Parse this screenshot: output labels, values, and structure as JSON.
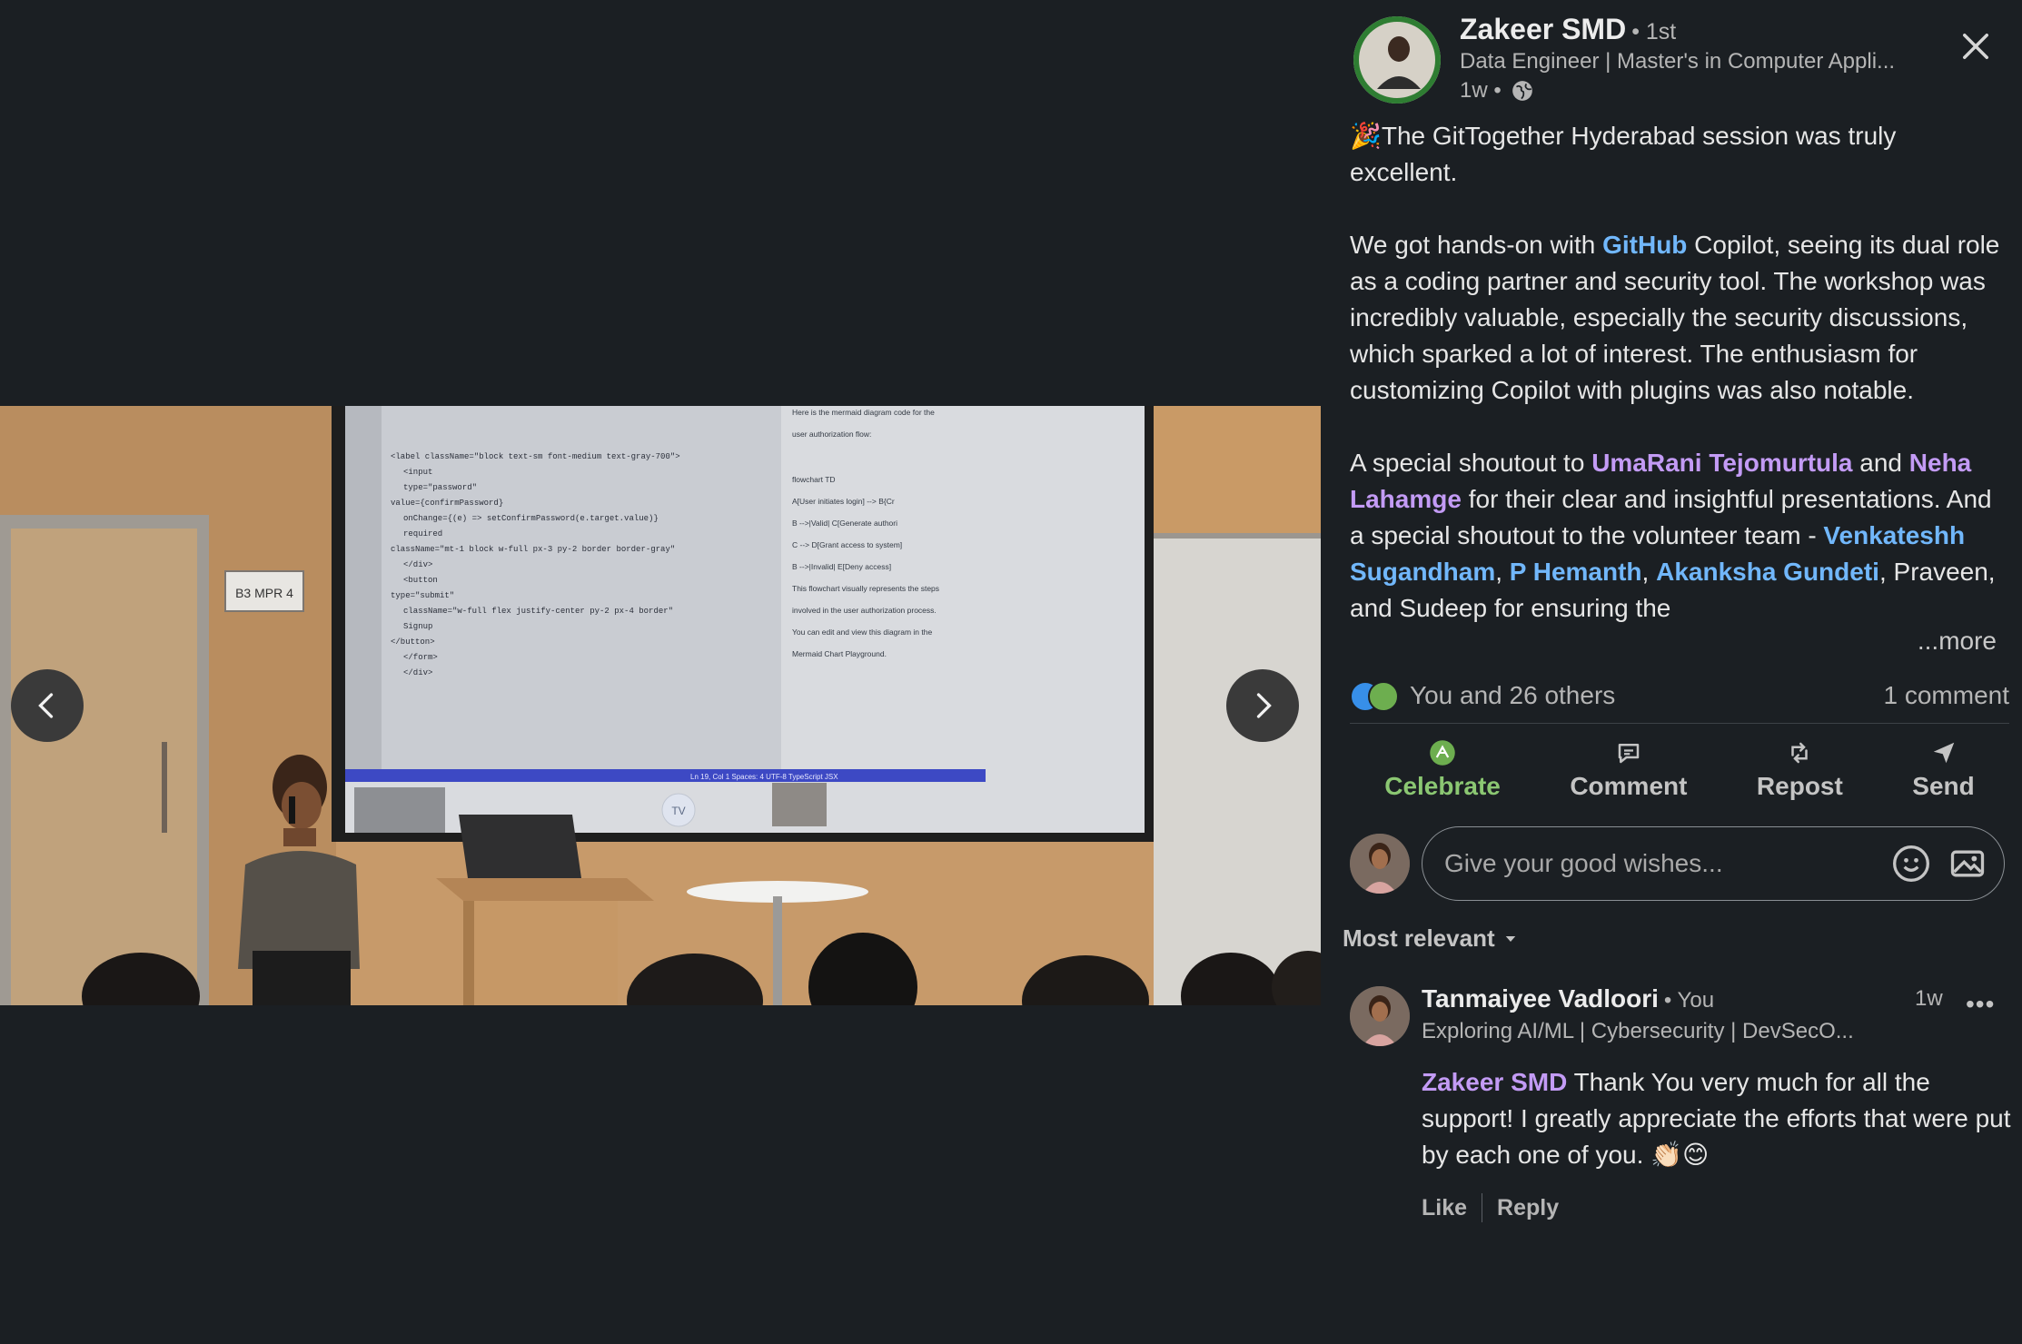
{
  "media": {
    "room_sign": "B3 MPR 4",
    "screen_badge": "TV",
    "code_lines": [
      "<label className=\"block text-sm font-medium text-gray-700\">",
      "<input",
      "type=\"password\"",
      "value={confirmPassword}",
      "onChange={(e) => setConfirmPassword(e.target.value)}",
      "required",
      "className=\"mt-1 block w-full px-3 py-2 border border-gray\"",
      "</div>",
      "<button",
      "type=\"submit\"",
      "className=\"w-full flex justify-center py-2 px-4 border\"",
      "Signup",
      "</button>",
      "</form>",
      "</div>"
    ],
    "chat_lines": [
      "Here is the mermaid diagram code for the",
      "user authorization flow:",
      "flowchart TD",
      "A[User initiates login] --> B{Cr",
      "B -->|Valid| C[Generate authori",
      "C --> D[Grant access to system]",
      "B -->|Invalid| E[Deny access]",
      "This flowchart visually represents the steps",
      "involved in the user authorization process.",
      "You can edit and view this diagram in the",
      "Mermaid Chart Playground."
    ],
    "status_bar": "Ln 19, Col 1   Spaces: 4   UTF-8   TypeScript JSX"
  },
  "post": {
    "author": {
      "name": "Zakeer SMD",
      "degree": "• 1st",
      "headline": "Data Engineer | Master's in Computer Appli...",
      "time": "1w •"
    },
    "paragraph1": "🎉The GitTogether Hyderabad session was truly excellent.",
    "p2_before": "We got hands-on with ",
    "p2_link": "GitHub",
    "p2_after": " Copilot, seeing its dual role as a coding partner and security tool. The workshop was incredibly valuable, especially the security discussions, which sparked a lot of interest. The enthusiasm for customizing Copilot with plugins was also notable.",
    "p3_a": "A special shoutout to ",
    "p3_mention1": "UmaRani Tejomurtula",
    "p3_b": " and ",
    "p3_mention2": "Neha Lahamge",
    "p3_c": " for their clear and insightful presentations. And a special shoutout to the volunteer team - ",
    "p3_mention3": "Venkateshh Sugandham",
    "p3_sep1": ", ",
    "p3_mention4": "P Hemanth",
    "p3_sep2": ", ",
    "p3_mention5": "Akanksha Gundeti",
    "p3_d": ", Praveen, and Sudeep for ensuring the",
    "more": "...more",
    "reactions_text": "You and 26 others",
    "comments_count": "1 comment"
  },
  "actions": {
    "celebrate": "Celebrate",
    "comment": "Comment",
    "repost": "Repost",
    "send": "Send"
  },
  "composer": {
    "placeholder": "Give your good wishes..."
  },
  "sort": {
    "label": "Most relevant"
  },
  "comment": {
    "name": "Tanmaiyee Vadloori",
    "you": "• You",
    "headline": "Exploring AI/ML | Cybersecurity | DevSecO...",
    "time": "1w",
    "menu": "•••",
    "mention": "Zakeer SMD",
    "text": " Thank You very much for all the support! I greatly appreciate the efforts that were put by each one of you. 👏🏻😊",
    "like": "Like",
    "reply": "Reply"
  },
  "colors": {
    "background": "#1b1f23",
    "link_blue": "#71b7fb",
    "mention_purple": "#c39bf5",
    "celebrate_green": "#8bc772"
  },
  "icons": [
    "close-icon",
    "globe-icon",
    "celebrate-icon",
    "comment-icon",
    "repost-icon",
    "send-icon",
    "emoji-icon",
    "image-icon",
    "chevron-left-icon",
    "chevron-right-icon",
    "caret-down-icon"
  ]
}
